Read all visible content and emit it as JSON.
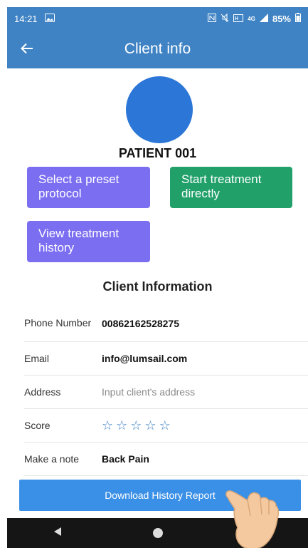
{
  "status_bar": {
    "time": "14:21",
    "battery": "85%",
    "network": "4G"
  },
  "app_bar": {
    "title": "Client info",
    "back_icon": "arrow-left-icon"
  },
  "patient": {
    "name": "PATIENT 001",
    "avatar_color": "#2b76d6"
  },
  "actions": {
    "preset_label": "Select a preset protocol",
    "start_label": "Start treatment directly",
    "history_label": "View treatment history"
  },
  "client_info": {
    "section_title": "Client Information",
    "phone_label": "Phone Number",
    "phone_value": "00862162528275",
    "email_label": "Email",
    "email_value": "info@lumsail.com",
    "address_label": "Address",
    "address_placeholder": "Input client's address",
    "score_label": "Score",
    "score_value": 0,
    "score_max": 5,
    "note_label": "Make a note",
    "note_value": "Back Pain"
  },
  "download": {
    "label": "Download History Report"
  },
  "colors": {
    "primary": "#3f83c4",
    "purple": "#7b6ef1",
    "green": "#21a06a",
    "download": "#3a8fe6"
  }
}
